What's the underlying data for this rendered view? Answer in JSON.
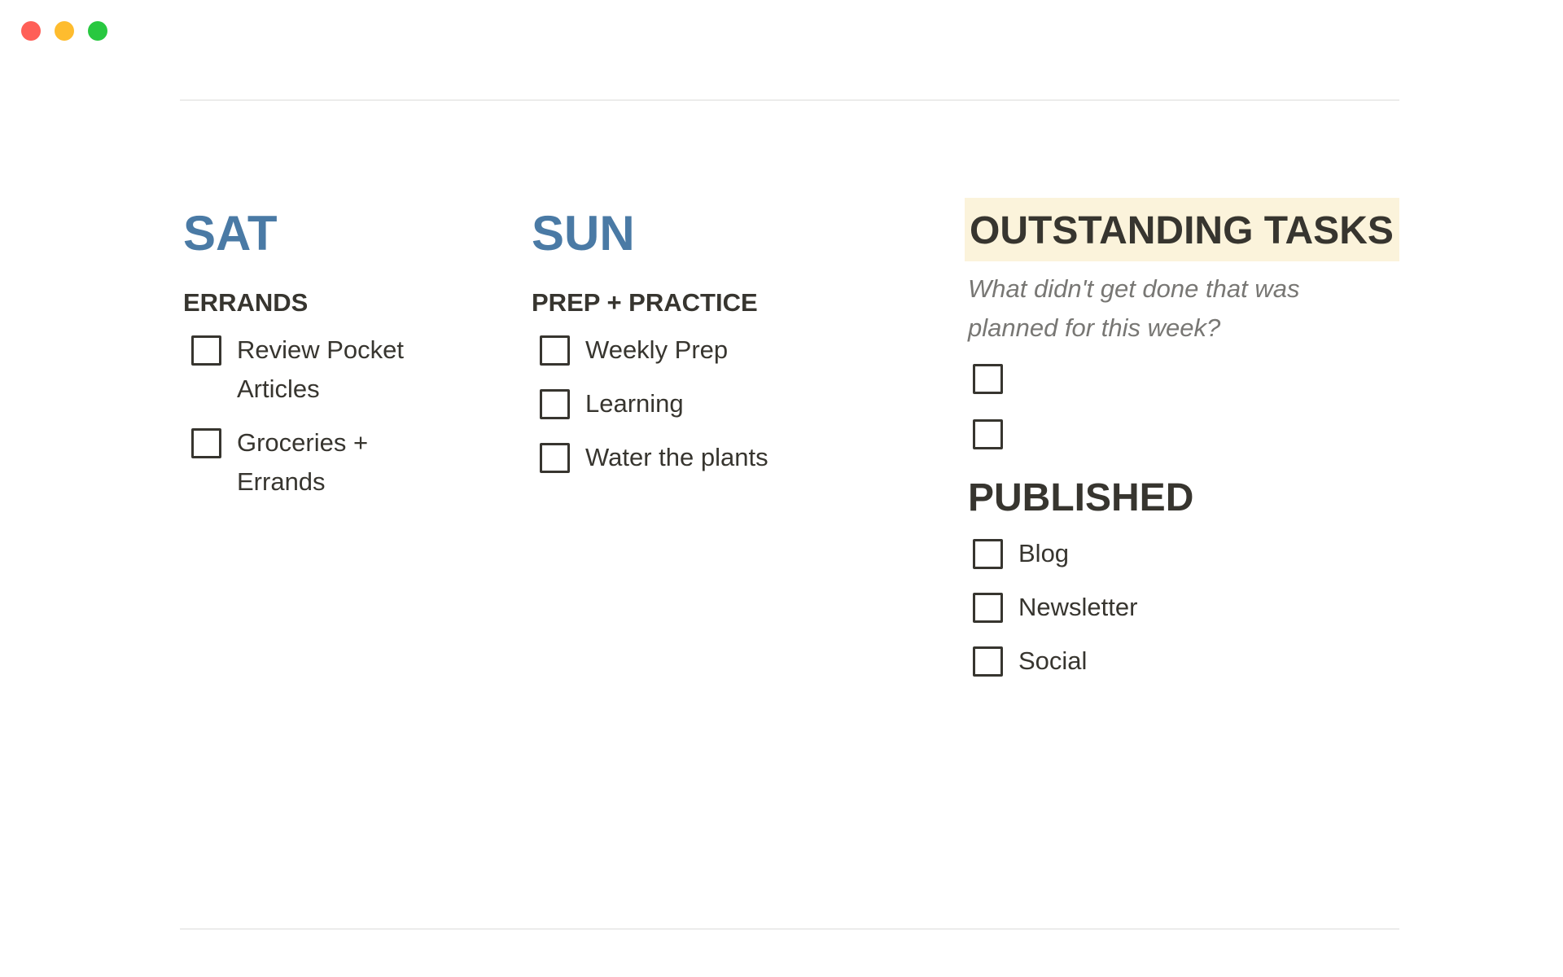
{
  "window_controls": {
    "close_color": "#ff5f57",
    "minimize_color": "#febc2e",
    "zoom_color": "#28c840"
  },
  "saturday": {
    "title": "SAT",
    "section_heading": "ERRANDS",
    "todos": [
      {
        "label": "Review Pocket Articles",
        "checked": false
      },
      {
        "label": "Groceries + Errands",
        "checked": false
      }
    ]
  },
  "sunday": {
    "title": "SUN",
    "section_heading": "PREP + PRACTICE",
    "todos": [
      {
        "label": "Weekly Prep",
        "checked": false
      },
      {
        "label": "Learning",
        "checked": false
      },
      {
        "label": "Water the plants",
        "checked": false
      }
    ]
  },
  "outstanding": {
    "title": "OUTSTANDING TASKS",
    "note": "What didn't get done that was planned for this week?",
    "todos": [
      {
        "label": "",
        "checked": false
      },
      {
        "label": "",
        "checked": false
      }
    ]
  },
  "published": {
    "title": "PUBLISHED",
    "todos": [
      {
        "label": "Blog",
        "checked": false
      },
      {
        "label": "Newsletter",
        "checked": false
      },
      {
        "label": "Social",
        "checked": false
      }
    ]
  },
  "colors": {
    "day_title": "#4a7aa5",
    "highlight_bg": "#fbf3db",
    "text": "#37352f",
    "muted_text": "#787774"
  }
}
